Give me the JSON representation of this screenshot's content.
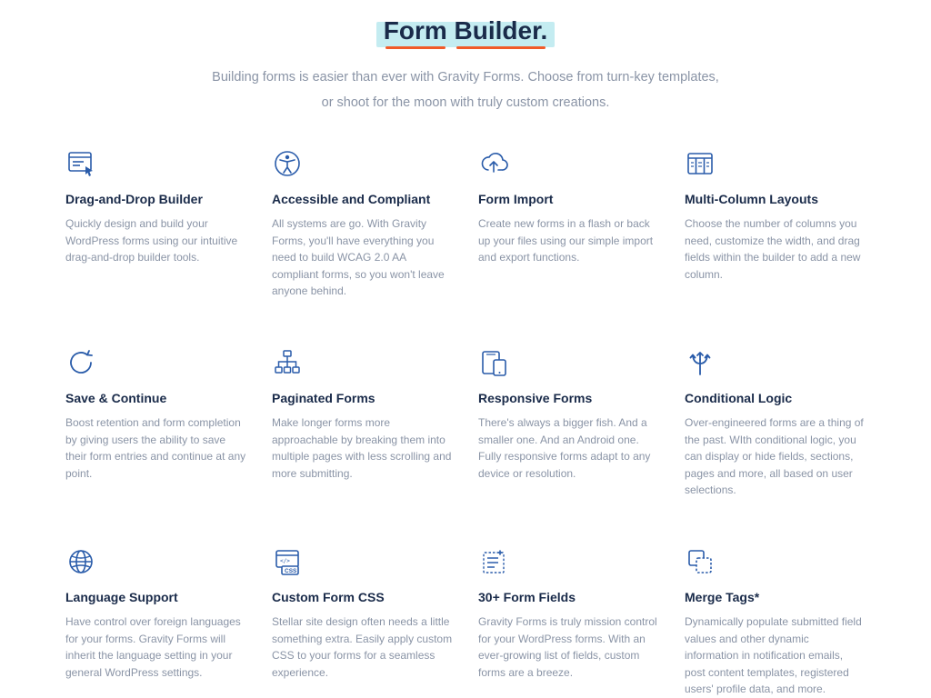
{
  "hero": {
    "title_words": [
      "Form",
      "Builder."
    ],
    "subtitle": "Building forms is easier than ever with Gravity Forms. Choose from turn-key templates, or shoot for the moon with truly custom creations."
  },
  "features": [
    {
      "icon": "drag-drop-builder-icon",
      "title": "Drag-and-Drop Builder",
      "desc": "Quickly design and build your WordPress forms using our intuitive drag-and-drop builder tools."
    },
    {
      "icon": "accessibility-icon",
      "title": "Accessible and Compliant",
      "desc": "All systems are go. With Gravity Forms, you'll have everything you need to build WCAG 2.0 AA compliant forms, so you won't leave anyone behind."
    },
    {
      "icon": "cloud-upload-icon",
      "title": "Form Import",
      "desc": "Create new forms in a flash or back up your files using our simple import and export functions."
    },
    {
      "icon": "columns-layout-icon",
      "title": "Multi-Column Layouts",
      "desc": "Choose the number of columns you need, customize the width, and drag fields within the builder to add a new column."
    },
    {
      "icon": "save-refresh-icon",
      "title": "Save & Continue",
      "desc": "Boost retention and form completion by giving users the ability to save their form entries and continue at any point."
    },
    {
      "icon": "paginated-tree-icon",
      "title": "Paginated Forms",
      "desc": "Make longer forms more approachable by breaking them into multiple pages with less scrolling and more submitting."
    },
    {
      "icon": "responsive-devices-icon",
      "title": "Responsive Forms",
      "desc": "There's always a bigger fish. And a smaller one. And an Android one. Fully responsive forms adapt to any device or resolution."
    },
    {
      "icon": "branching-arrows-icon",
      "title": "Conditional Logic",
      "desc": "Over-engineered forms are a thing of the past. WIth conditional logic, you can display or hide fields, sections, pages and more, all based on user selections."
    },
    {
      "icon": "globe-icon",
      "title": "Language Support",
      "desc": "Have control over foreign languages for your forms. Gravity Forms will inherit the language setting in your general WordPress settings."
    },
    {
      "icon": "css-window-icon",
      "title": "Custom Form CSS",
      "desc": "Stellar site design often needs a little something extra. Easily apply custom CSS to your forms for a seamless experience."
    },
    {
      "icon": "form-fields-icon",
      "title": "30+ Form Fields",
      "desc": "Gravity Forms is truly mission control for your WordPress forms. With an ever-growing list of fields, custom forms are a breeze."
    },
    {
      "icon": "merge-tags-icon",
      "title": "Merge Tags*",
      "desc": "Dynamically populate submitted field values and other dynamic information in notification emails, post content templates, registered users' profile data, and more."
    }
  ],
  "colors": {
    "accent": "#2a5caa",
    "highlight": "#c4ecf1",
    "underline": "#f15a29",
    "text_muted": "#8a94a6",
    "text_dark": "#1a2b4a"
  }
}
